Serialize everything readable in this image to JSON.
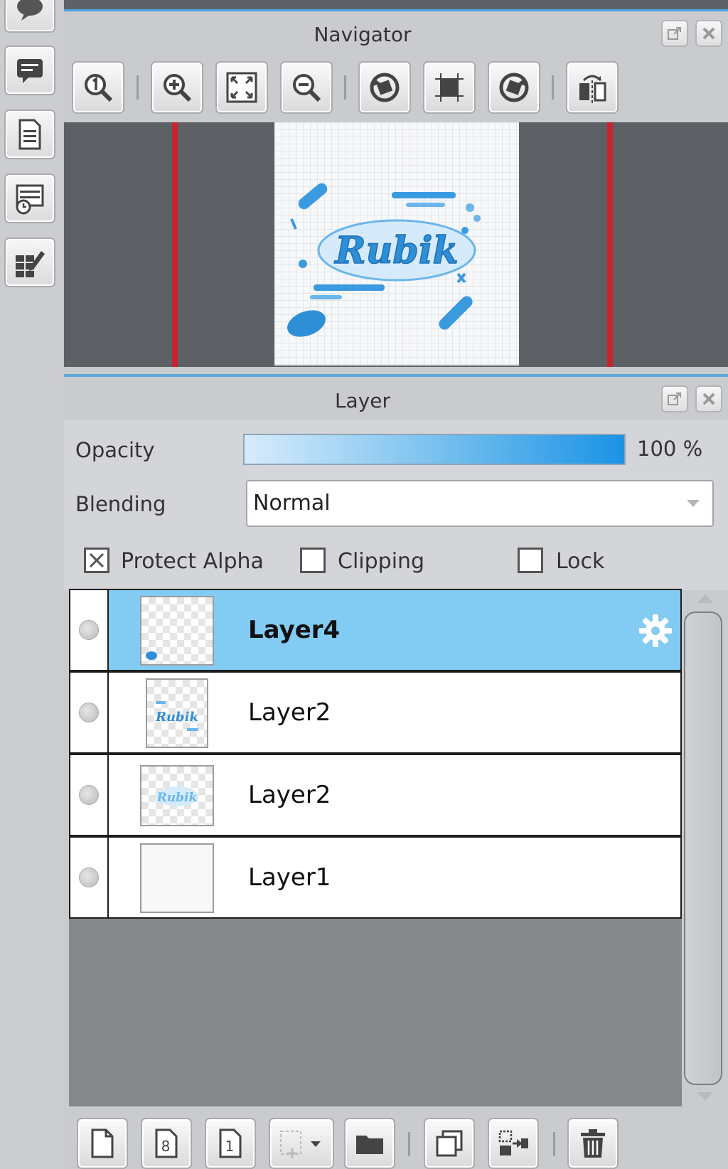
{
  "navigator": {
    "title": "Navigator",
    "toolbar": [
      "actual-size",
      "zoom-in",
      "fit-window",
      "zoom-out",
      "rotate-left",
      "reset-rotation",
      "rotate-right",
      "flip-horizontal"
    ],
    "preview_text": "Rubik"
  },
  "layer_panel": {
    "title": "Layer",
    "opacity_label": "Opacity",
    "opacity_value": "100 %",
    "opacity_fraction": 1.0,
    "blending_label": "Blending",
    "blending_value": "Normal",
    "protect_alpha_label": "Protect Alpha",
    "protect_alpha_checked": true,
    "clipping_label": "Clipping",
    "clipping_checked": false,
    "lock_label": "Lock",
    "lock_checked": false,
    "layers": [
      {
        "name": "Layer4",
        "selected": true
      },
      {
        "name": "Layer2",
        "selected": false
      },
      {
        "name": "Layer2",
        "selected": false
      },
      {
        "name": "Layer1",
        "selected": false
      }
    ]
  },
  "colors": {
    "accent": "#4da6e3",
    "selected_row": "#82ccf4",
    "preview_border": "#c7252e",
    "thumb_art": "#2f8fd6"
  }
}
